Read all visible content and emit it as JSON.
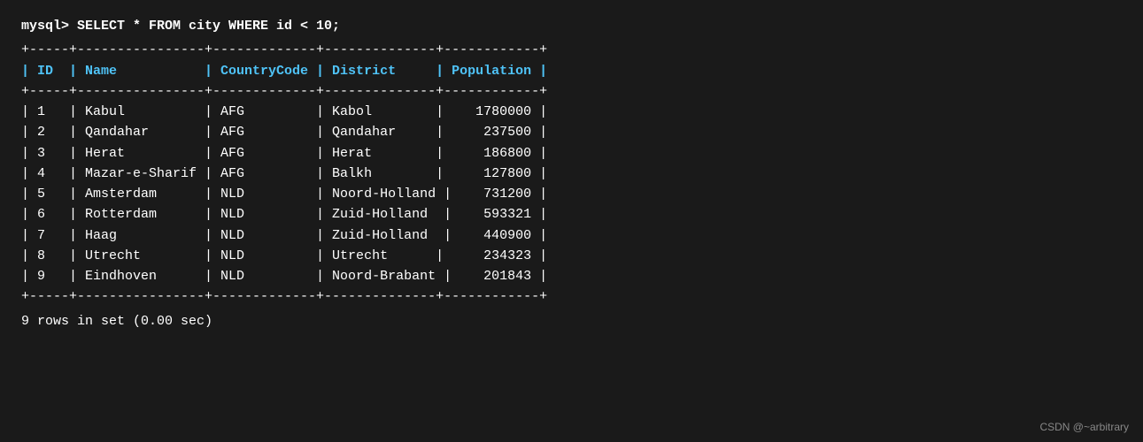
{
  "terminal": {
    "command": "mysql> SELECT * FROM city WHERE id < 10;",
    "separator_top": "+-----+----------------+-------------+--------------+------------+",
    "header": "| ID  | Name           | CountryCode | District     | Population |",
    "separator_mid": "+-----+----------------+-------------+--------------+------------+",
    "rows": [
      "| 1   | Kabul          | AFG         | Kabol        |    1780000 |",
      "| 2   | Qandahar       | AFG         | Qandahar     |     237500 |",
      "| 3   | Herat          | AFG         | Herat        |     186800 |",
      "| 4   | Mazar-e-Sharif | AFG         | Balkh        |     127800 |",
      "| 5   | Amsterdam      | NLD         | Noord-Holland |    731200 |",
      "| 6   | Rotterdam      | NLD         | Zuid-Holland  |    593321 |",
      "| 7   | Haag           | NLD         | Zuid-Holland  |    440900 |",
      "| 8   | Utrecht        | NLD         | Utrecht      |     234323 |",
      "| 9   | Eindhoven      | NLD         | Noord-Brabant |    201843 |"
    ],
    "separator_bottom": "+-----+----------------+-------------+--------------+------------+",
    "footer": "9 rows in set (0.00 sec)",
    "watermark": "CSDN @~arbitrary"
  }
}
